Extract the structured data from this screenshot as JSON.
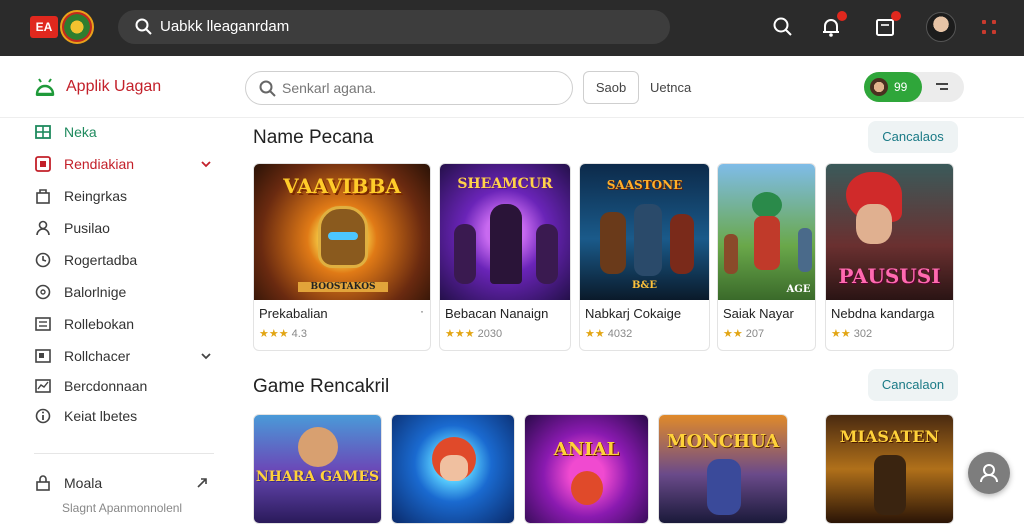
{
  "topbar": {
    "logo_text": "EA",
    "search_text": "Uabkk lleaganrdam"
  },
  "header": {
    "app_title": "Applik Uagan",
    "search_placeholder": "Senkarl agana.",
    "search_button": "Saob",
    "link": "Uetnca",
    "points": "99"
  },
  "sidebar": {
    "items": [
      {
        "label": "Neka",
        "icon": "grid-icon"
      },
      {
        "label": "Rendiakian",
        "icon": "square-icon"
      },
      {
        "label": "Reingrkas",
        "icon": "bag-icon"
      },
      {
        "label": "Pusilao",
        "icon": "user-icon"
      },
      {
        "label": "Rogertadba",
        "icon": "clock-icon"
      },
      {
        "label": "Balorlnige",
        "icon": "dial-icon"
      },
      {
        "label": "Rollebokan",
        "icon": "list-icon"
      },
      {
        "label": "Rollchacer",
        "icon": "board-icon"
      },
      {
        "label": "Bercdonnaan",
        "icon": "chart-icon"
      },
      {
        "label": "Keiat lbetes",
        "icon": "info-icon"
      },
      {
        "label": "Moala",
        "icon": "lock-icon"
      }
    ],
    "footer_text": "Slagnt Apanmonnolenl"
  },
  "sections": [
    {
      "title": "Name Pecana",
      "see_all": "Cancalaos"
    },
    {
      "title": "Game Rencakril",
      "see_all": "Cancalaon"
    }
  ],
  "games": [
    {
      "art": "VAAVIBBA",
      "art2": "BOOSTAKOS",
      "title": "Prekabalian",
      "rating": "4.3"
    },
    {
      "art": "SHEAMCUR",
      "art2": "",
      "title": "Bebacan Nanaign",
      "rating": "2030"
    },
    {
      "art": "SAASTONE",
      "art2": "B&E",
      "title": "Nabkarj Cokaige",
      "rating": "4032"
    },
    {
      "art": "",
      "art2": "AGE",
      "title": "Saiak Nayar",
      "rating": "207"
    },
    {
      "art": "PAUSUSI",
      "art2": "",
      "title": "Nebdna kandarga",
      "rating": "302"
    }
  ],
  "games2": [
    {
      "art": "NHARA GAMES"
    },
    {
      "art": ""
    },
    {
      "art": "ANIAL"
    },
    {
      "art": "MONCHUA"
    },
    {
      "art": "MIASATEN"
    }
  ],
  "colors": {
    "brand_red": "#c3202a",
    "accent_green": "#2fa63a",
    "topbar": "#2b2b2b"
  }
}
